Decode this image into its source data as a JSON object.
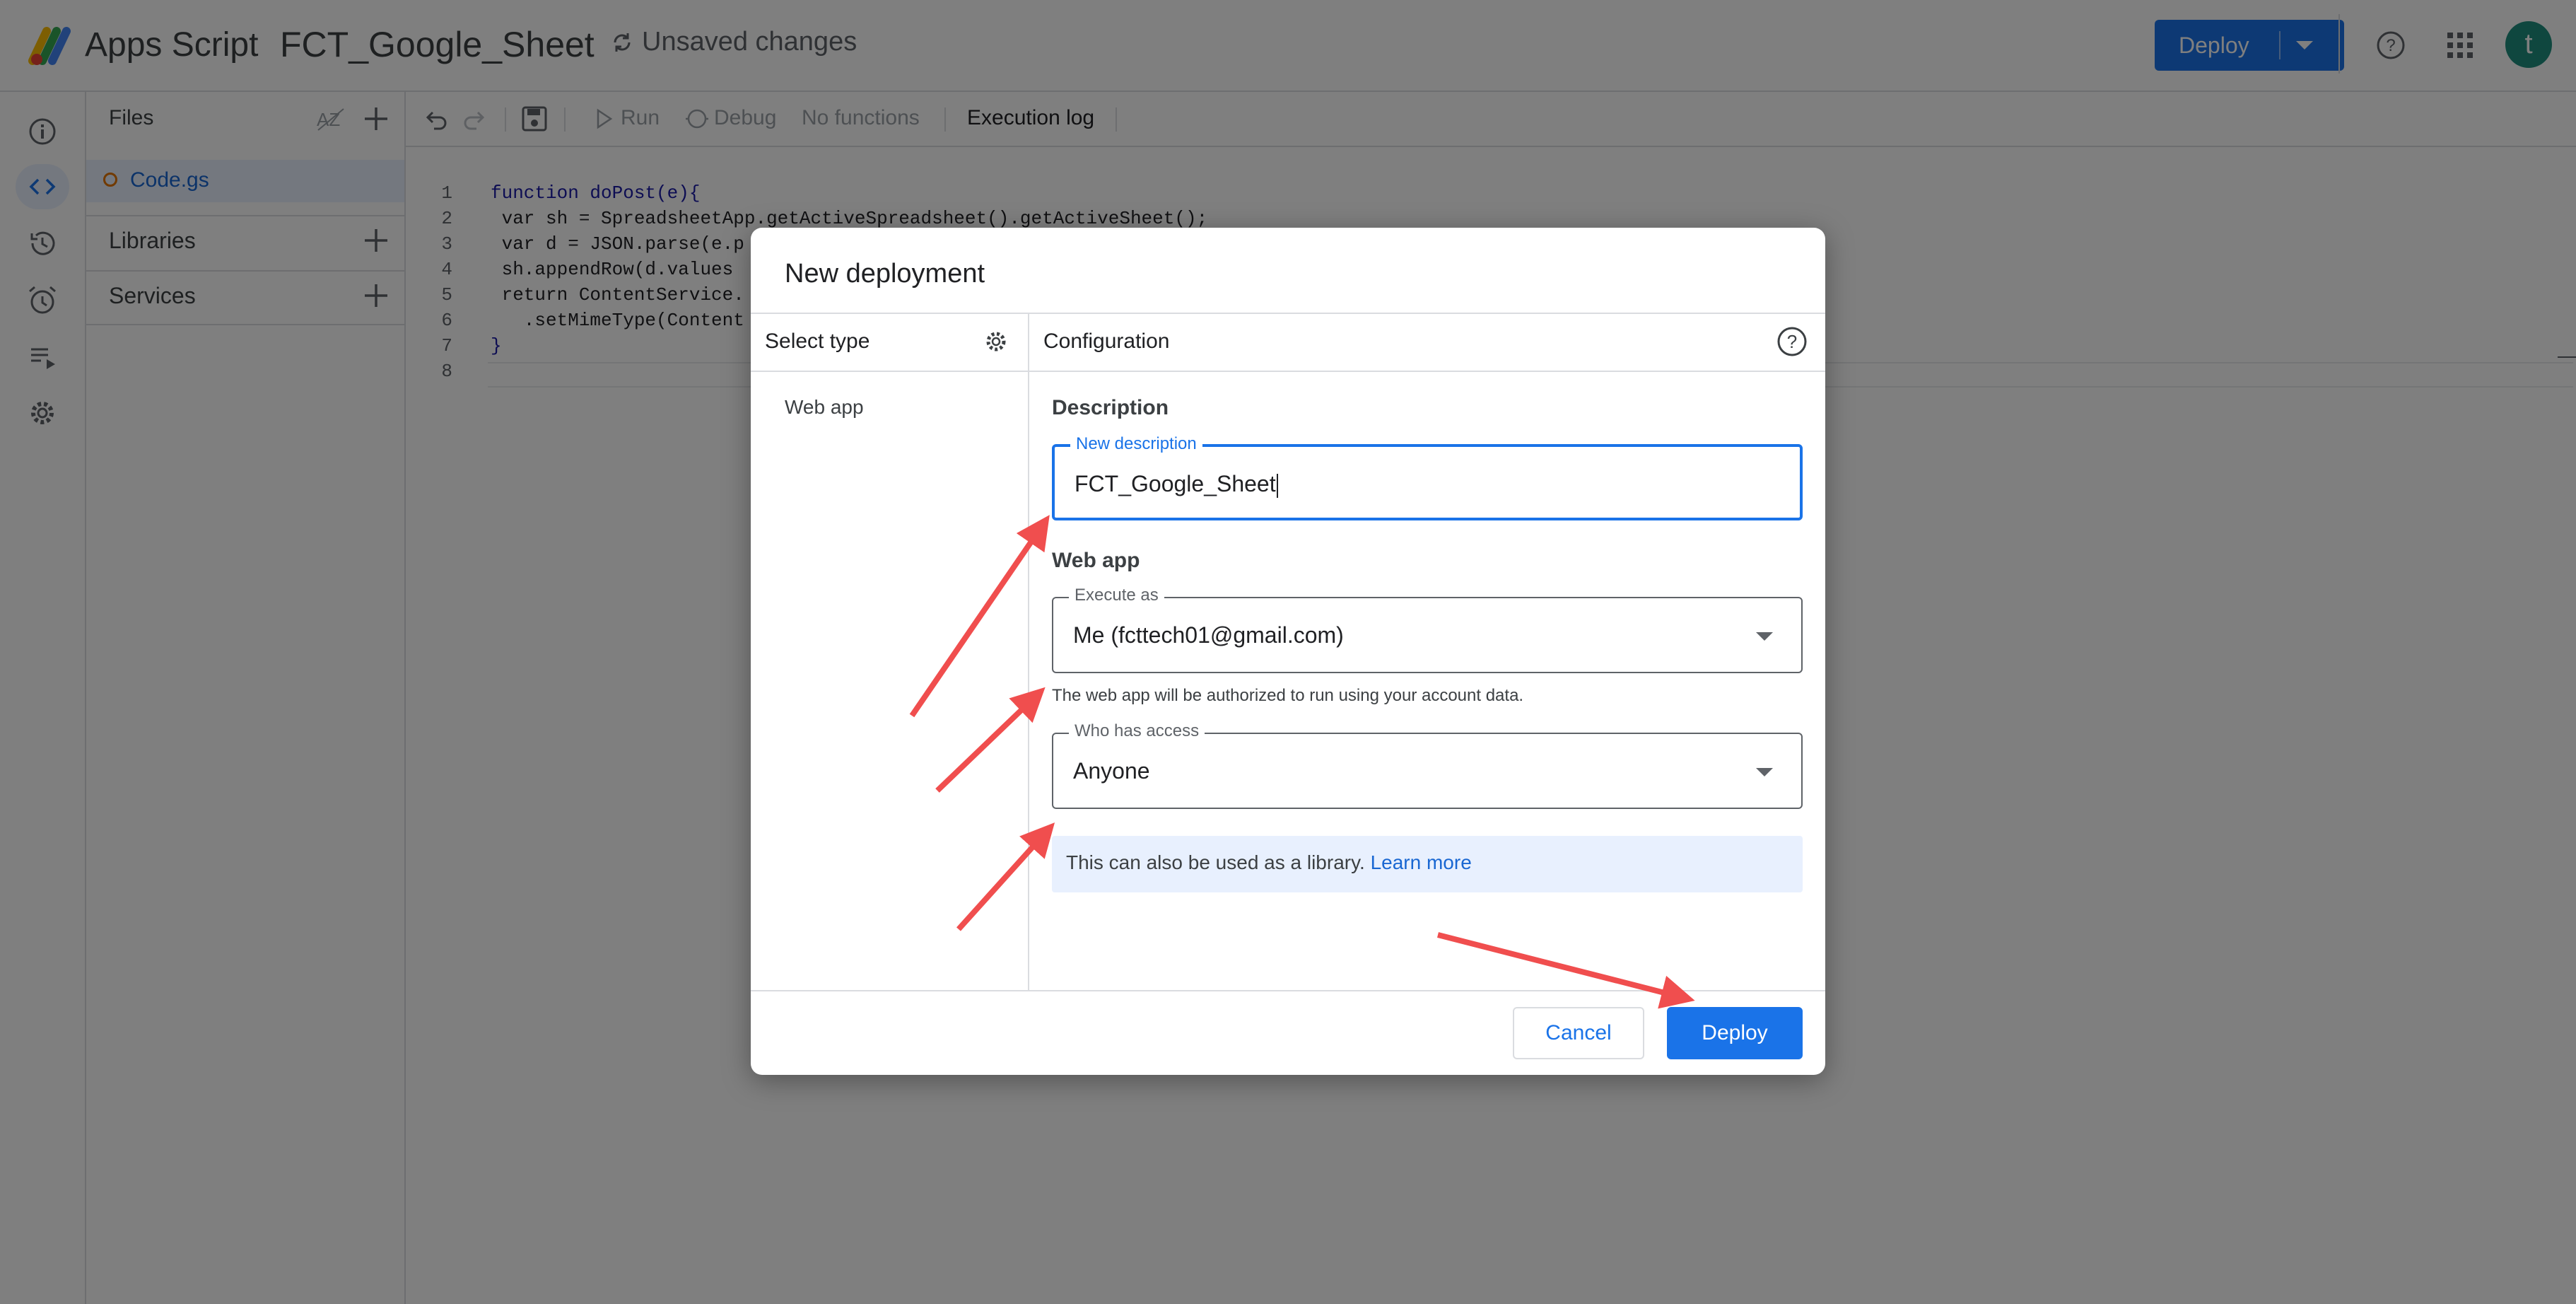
{
  "header": {
    "app_name": "Apps Script",
    "project_title": "FCT_Google_Sheet",
    "status": "Unsaved changes",
    "deploy_label": "Deploy",
    "avatar_initial": "t"
  },
  "files_panel": {
    "title": "Files",
    "files": [
      {
        "name": "Code.gs"
      }
    ],
    "libraries_label": "Libraries",
    "services_label": "Services"
  },
  "toolbar": {
    "run_label": "Run",
    "debug_label": "Debug",
    "function_select": "No functions",
    "execution_log_label": "Execution log"
  },
  "editor": {
    "lines": [
      {
        "num": "1",
        "text": "function doPost(e){"
      },
      {
        "num": "2",
        "text": " var sh = SpreadsheetApp.getActiveSpreadsheet().getActiveSheet();"
      },
      {
        "num": "3",
        "text": " var d = JSON.parse(e.p"
      },
      {
        "num": "4",
        "text": " sh.appendRow(d.values"
      },
      {
        "num": "5",
        "text": " return ContentService."
      },
      {
        "num": "6",
        "text": "   .setMimeType(Content"
      },
      {
        "num": "7",
        "text": "}"
      },
      {
        "num": "8",
        "text": ""
      }
    ]
  },
  "dialog": {
    "title": "New deployment",
    "select_type_label": "Select type",
    "configuration_label": "Configuration",
    "types": [
      "Web app"
    ],
    "description_heading": "Description",
    "description_field": {
      "label": "New description",
      "value": "FCT_Google_Sheet"
    },
    "webapp_heading": "Web app",
    "execute_as": {
      "label": "Execute as",
      "value": "Me (fcttech01@gmail.com)"
    },
    "execute_help": "The web app will be authorized to run using your account data.",
    "who_has_access": {
      "label": "Who has access",
      "value": "Anyone"
    },
    "library_note": "This can also be used as a library.",
    "learn_more": "Learn more",
    "cancel_label": "Cancel",
    "deploy_label": "Deploy"
  },
  "colors": {
    "accent": "#1a73e8",
    "annotation_arrow": "#f04e4e"
  }
}
